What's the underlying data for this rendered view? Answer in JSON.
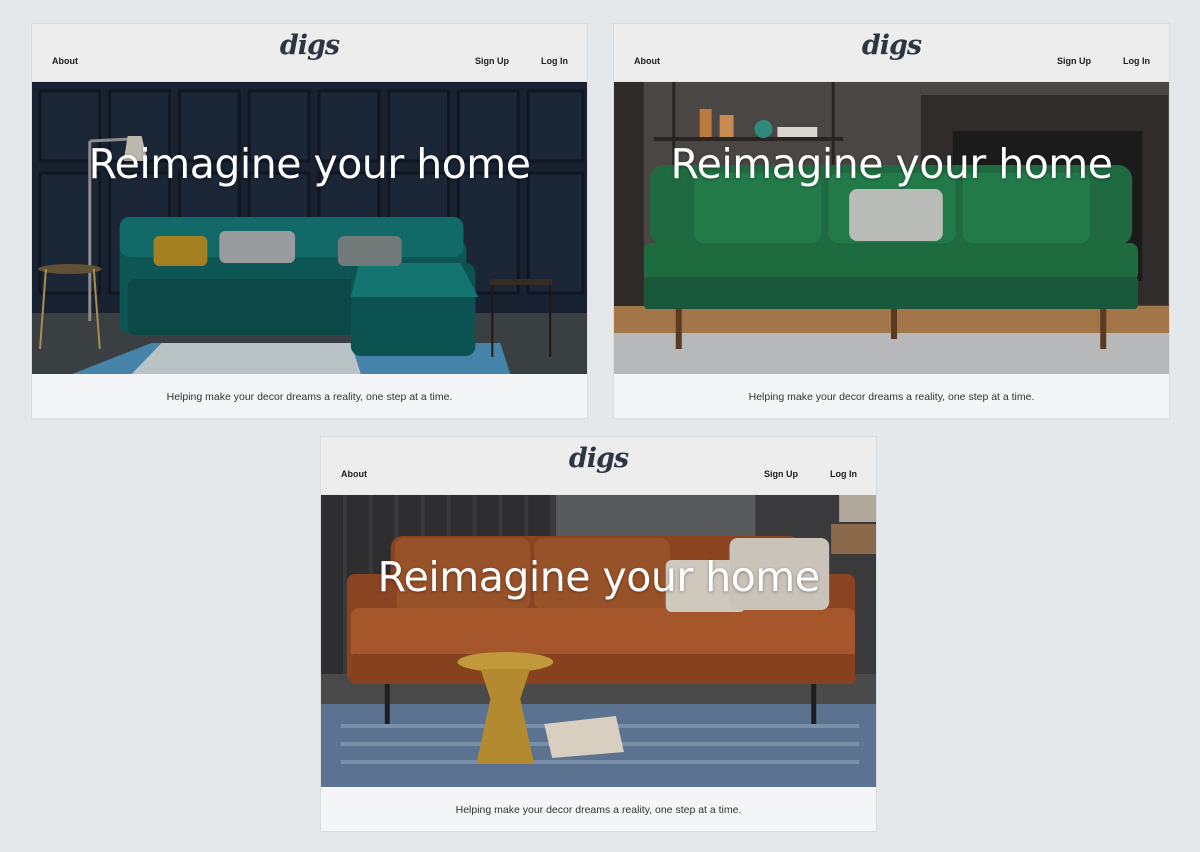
{
  "mockups": [
    {
      "nav": {
        "about": "About",
        "signup": "Sign Up",
        "login": "Log In"
      },
      "logo": "digs",
      "headline": "Reimagine your home",
      "tagline": "Helping make your decor dreams a reality, one step at a time.",
      "hero_image": "teal-velvet-sectional-sofa"
    },
    {
      "nav": {
        "about": "About",
        "signup": "Sign Up",
        "login": "Log In"
      },
      "logo": "digs",
      "headline": "Reimagine your home",
      "tagline": "Helping make your decor dreams a reality, one step at a time.",
      "hero_image": "green-velvet-sofa"
    },
    {
      "nav": {
        "about": "About",
        "signup": "Sign Up",
        "login": "Log In"
      },
      "logo": "digs",
      "headline": "Reimagine your home",
      "tagline": "Helping make your decor dreams a reality, one step at a time.",
      "hero_image": "brown-leather-sofa"
    }
  ]
}
